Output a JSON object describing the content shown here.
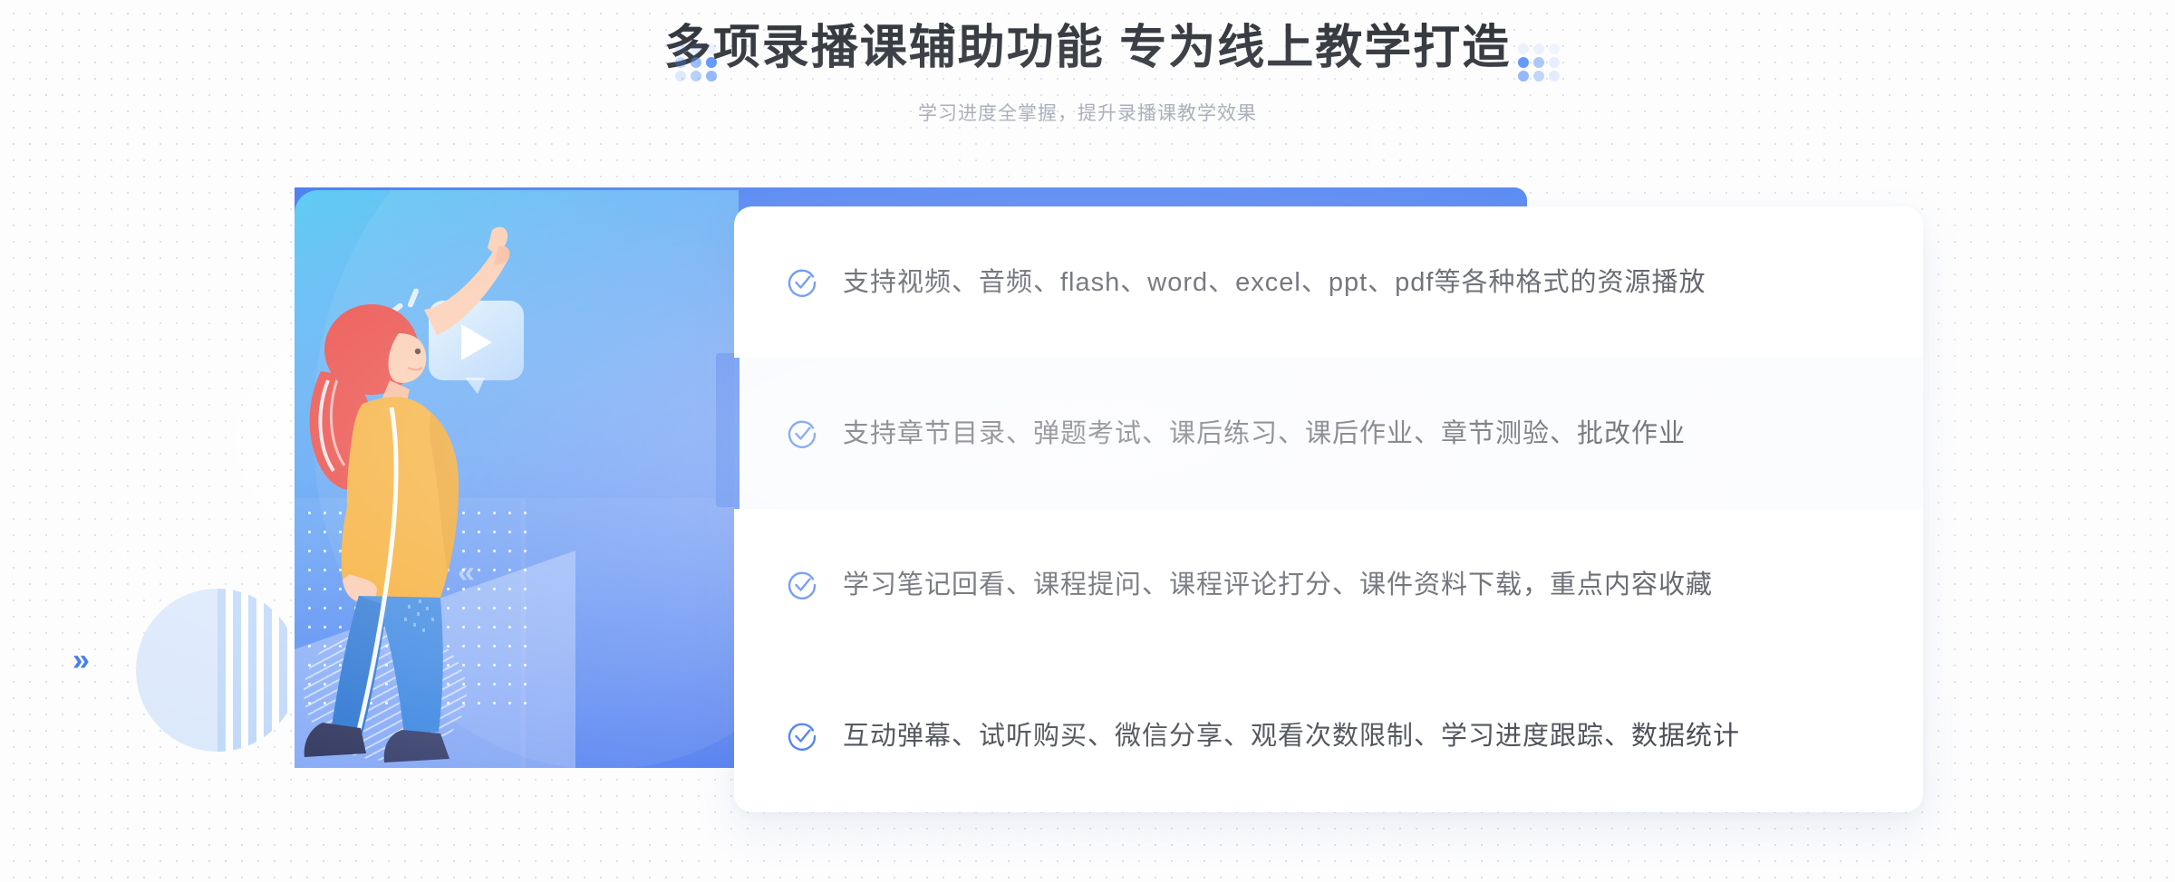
{
  "header": {
    "title": "多项录播课辅助功能 专为线上教学打造",
    "subtitle": "学习进度全掌握，提升录播课教学效果"
  },
  "colors": {
    "accent_blue": "#2f6cef",
    "panel_gradient_start": "#44c3f2",
    "panel_gradient_end": "#3668ef",
    "title_text": "#282c33",
    "subtitle_text": "#9aa0ac",
    "body_text": "#2b2f38",
    "active_row_bg": "#f7f9fd",
    "deco_circle": "#d9e7fb",
    "page_bg": "#fdfdfe"
  },
  "illustration": {
    "name": "person-pointing-at-video-play-bubble",
    "play_icon": "play-triangle-icon",
    "bubble": "video-speech-bubble",
    "shirt_color": "#f5a623",
    "hair_color": "#e8342f",
    "pants_color": "#2f7fe0",
    "shoe_color": "#242a55",
    "skin_color": "#fbc6a8",
    "chevron_inner": "«"
  },
  "decorations": {
    "left_chevron": "»",
    "dot_cluster_color": "#3a7df5"
  },
  "features": [
    {
      "icon": "check-circle-icon",
      "text": "支持视频、音频、flash、word、excel、ppt、pdf等各种格式的资源播放",
      "active": false
    },
    {
      "icon": "check-circle-icon",
      "text": "支持章节目录、弹题考试、课后练习、课后作业、章节测验、批改作业",
      "active": true
    },
    {
      "icon": "check-circle-icon",
      "text": "学习笔记回看、课程提问、课程评论打分、课件资料下载，重点内容收藏",
      "active": false
    },
    {
      "icon": "check-circle-icon",
      "text": "互动弹幕、试听购买、微信分享、观看次数限制、学习进度跟踪、数据统计",
      "active": false
    }
  ]
}
